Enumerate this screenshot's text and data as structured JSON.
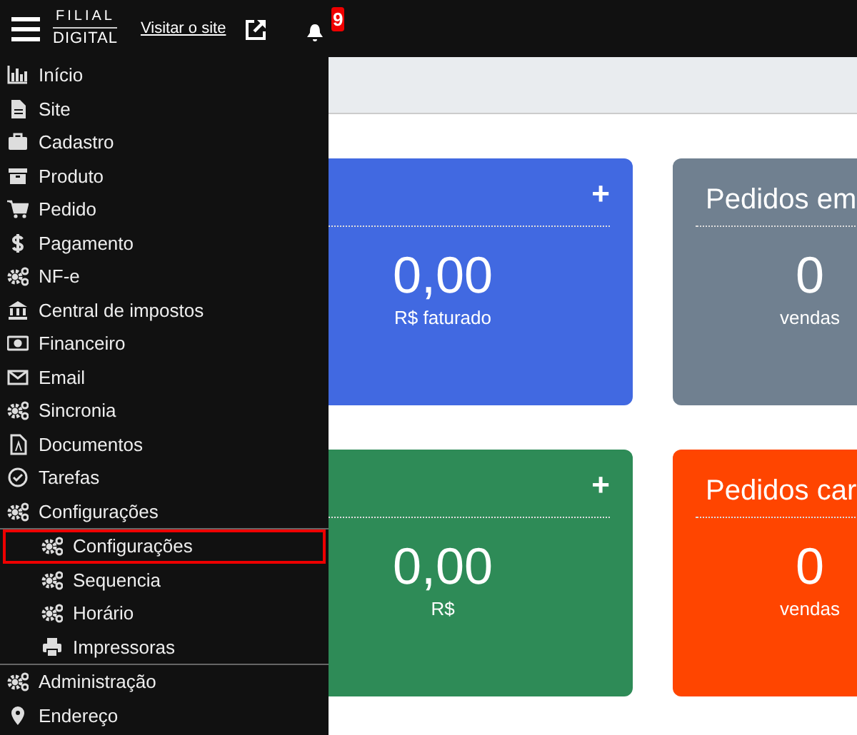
{
  "header": {
    "logo_top": "FILIAL",
    "logo_bottom": "DIGITAL",
    "site_link": "Visitar o site",
    "notification_count": "9"
  },
  "sidebar": {
    "items": [
      {
        "label": "Início"
      },
      {
        "label": "Site"
      },
      {
        "label": "Cadastro"
      },
      {
        "label": "Produto"
      },
      {
        "label": "Pedido"
      },
      {
        "label": "Pagamento"
      },
      {
        "label": "NF-e"
      },
      {
        "label": "Central de impostos"
      },
      {
        "label": "Financeiro"
      },
      {
        "label": "Email"
      },
      {
        "label": "Sincronia"
      },
      {
        "label": "Documentos"
      },
      {
        "label": "Tarefas"
      },
      {
        "label": "Configurações",
        "children": [
          {
            "label": "Configurações",
            "selected": true
          },
          {
            "label": "Sequencia",
            "selected": false
          },
          {
            "label": "Horário",
            "selected": false
          },
          {
            "label": "Impressoras",
            "selected": false
          }
        ]
      },
      {
        "label": "Administração"
      },
      {
        "label": "Endereço"
      }
    ]
  },
  "cards": [
    {
      "action": "+",
      "value": "0,00",
      "caption": "R$ faturado",
      "color": "#4169e1"
    },
    {
      "title": "Pedidos em",
      "value": "0",
      "caption": "vendas",
      "color": "#708090"
    },
    {
      "action": "+",
      "value": "0,00",
      "caption": "R$",
      "color": "#2e8b57"
    },
    {
      "title": "Pedidos car",
      "value": "0",
      "caption": "vendas",
      "color": "#ff4500"
    }
  ]
}
